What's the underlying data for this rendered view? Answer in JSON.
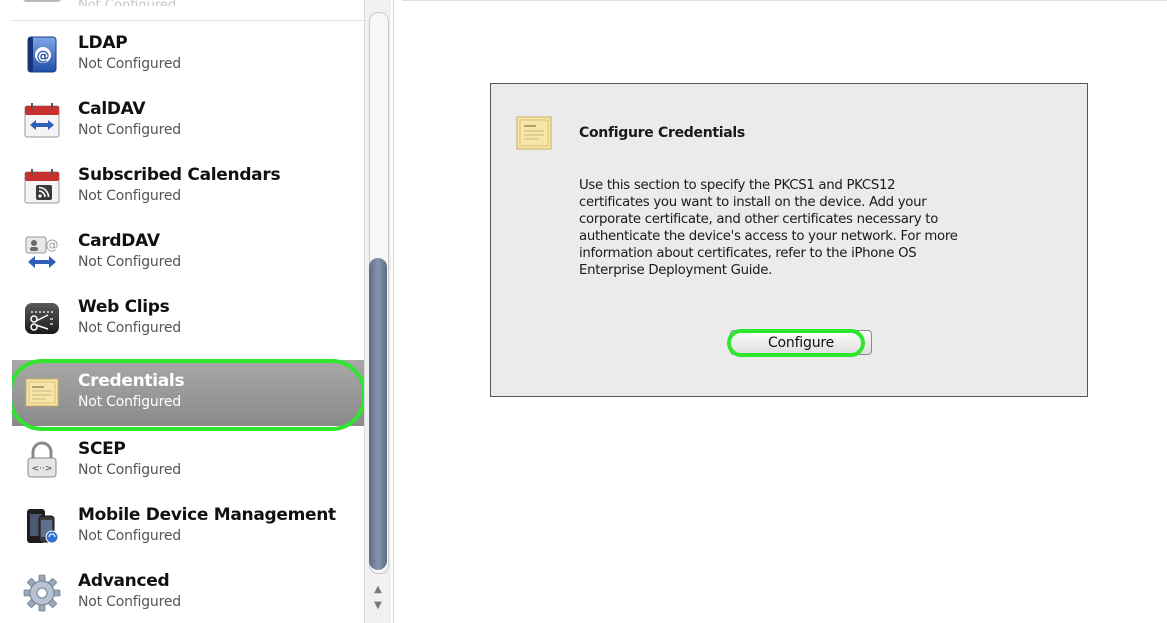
{
  "sidebar": {
    "items": [
      {
        "label": "LDAP",
        "status": "Not Configured",
        "icon": "ldap-icon"
      },
      {
        "label": "CalDAV",
        "status": "Not Configured",
        "icon": "caldav-icon"
      },
      {
        "label": "Subscribed Calendars",
        "status": "Not Configured",
        "icon": "subscribed-calendars-icon"
      },
      {
        "label": "CardDAV",
        "status": "Not Configured",
        "icon": "carddav-icon"
      },
      {
        "label": "Web Clips",
        "status": "Not Configured",
        "icon": "web-clips-icon"
      },
      {
        "label": "Credentials",
        "status": "Not Configured",
        "icon": "credentials-icon",
        "selected": true
      },
      {
        "label": "SCEP",
        "status": "Not Configured",
        "icon": "scep-icon"
      },
      {
        "label": "Mobile Device Management",
        "status": "Not Configured",
        "icon": "mobile-device-management-icon"
      },
      {
        "label": "Advanced",
        "status": "Not Configured",
        "icon": "advanced-icon"
      }
    ],
    "partial_item_status": "Not Configured"
  },
  "panel": {
    "title": "Configure Credentials",
    "icon": "certificate-icon",
    "description_lines": [
      "Use this section to specify the PKCS1 and PKCS12",
      "certificates you want to install on the device. Add your",
      "corporate certificate, and other certificates necessary to",
      "authenticate the device's access to your network. For more",
      "information about certificates, refer to the iPhone OS",
      "Enterprise Deployment Guide."
    ],
    "button_label": "Configure"
  },
  "colors": {
    "highlight": "#2ee62e",
    "selected_row": "#9a9a9a",
    "scroll_thumb": "#6f7f98",
    "panel_background": "#ebebeb"
  }
}
